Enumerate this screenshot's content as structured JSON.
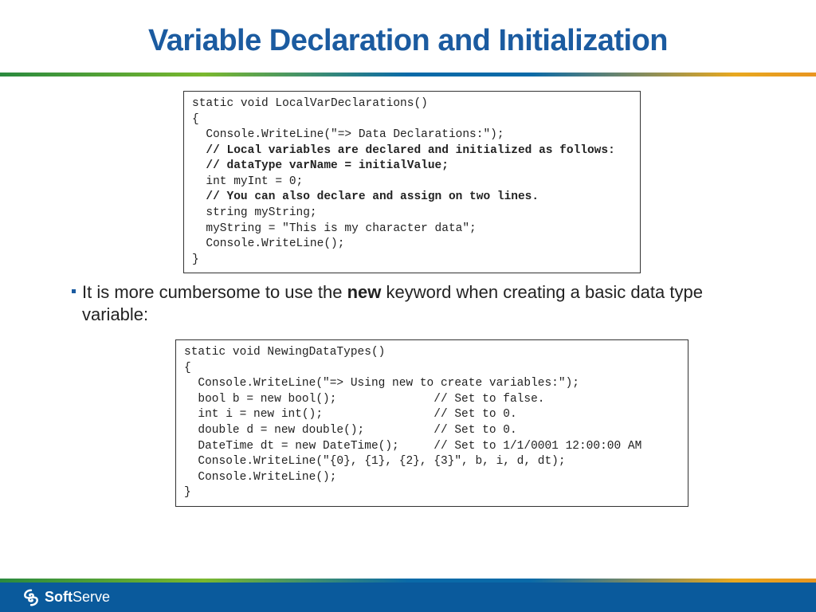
{
  "title": "Variable Declaration and Initialization",
  "code1": {
    "line0": "static void LocalVarDeclarations()",
    "line1": "{",
    "line2": "  Console.WriteLine(\"=> Data Declarations:\");",
    "line3": "  // Local variables are declared and initialized as follows:",
    "line4": "  // dataType varName = initialValue;",
    "line5": "  int myInt = 0;",
    "line6": "",
    "line7": "  // You can also declare and assign on two lines.",
    "line8": "  string myString;",
    "line9": "  myString = \"This is my character data\";",
    "line10": "",
    "line11": "  Console.WriteLine();",
    "line12": "}"
  },
  "bullet": {
    "pre": "It is more cumbersome to use the ",
    "bold": "new",
    "post": " keyword when creating a basic data type variable:"
  },
  "code2": {
    "line0": "static void NewingDataTypes()",
    "line1": "{",
    "line2": "  Console.WriteLine(\"=> Using new to create variables:\");",
    "line3": "  bool b = new bool();              // Set to false.",
    "line4": "  int i = new int();                // Set to 0.",
    "line5": "  double d = new double();          // Set to 0.",
    "line6": "  DateTime dt = new DateTime();     // Set to 1/1/0001 12:00:00 AM",
    "line7": "  Console.WriteLine(\"{0}, {1}, {2}, {3}\", b, i, d, dt);",
    "line8": "  Console.WriteLine();",
    "line9": "}"
  },
  "footer": {
    "brand_bold": "Soft",
    "brand_light": "Serve"
  }
}
